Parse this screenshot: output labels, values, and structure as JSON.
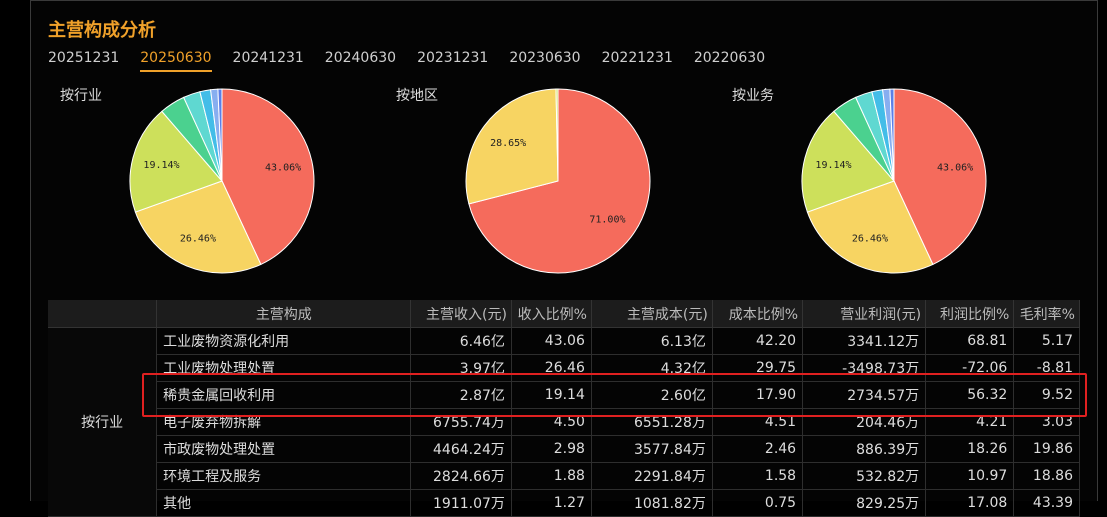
{
  "title": "主营构成分析",
  "tabs": [
    "20251231",
    "20250630",
    "20241231",
    "20240630",
    "20231231",
    "20230630",
    "20221231",
    "20220630"
  ],
  "active_tab": 1,
  "chart_data": [
    {
      "type": "pie",
      "title": "按行业",
      "slices": [
        {
          "value": 43.06,
          "label": "43.06%",
          "color": "#f56b5c"
        },
        {
          "value": 26.46,
          "label": "26.46%",
          "color": "#f7d462"
        },
        {
          "value": 19.14,
          "label": "19.14%",
          "color": "#cde05b"
        },
        {
          "value": 4.5,
          "label": "",
          "color": "#4bd18f"
        },
        {
          "value": 2.98,
          "label": "",
          "color": "#5fd8d1"
        },
        {
          "value": 1.88,
          "label": "",
          "color": "#43bde8"
        },
        {
          "value": 1.27,
          "label": "",
          "color": "#87aef0"
        },
        {
          "value": 0.71,
          "label": "",
          "color": "#5b7fe8"
        }
      ]
    },
    {
      "type": "pie",
      "title": "按地区",
      "slices": [
        {
          "value": 71.0,
          "label": "71.00%",
          "color": "#f56b5c"
        },
        {
          "value": 28.65,
          "label": "28.65%",
          "color": "#f7d462"
        },
        {
          "value": 0.35,
          "label": "",
          "color": "#cde05b"
        }
      ]
    },
    {
      "type": "pie",
      "title": "按业务",
      "slices": [
        {
          "value": 43.06,
          "label": "43.06%",
          "color": "#f56b5c"
        },
        {
          "value": 26.46,
          "label": "26.46%",
          "color": "#f7d462"
        },
        {
          "value": 19.14,
          "label": "19.14%",
          "color": "#cde05b"
        },
        {
          "value": 4.5,
          "label": "",
          "color": "#4bd18f"
        },
        {
          "value": 2.98,
          "label": "",
          "color": "#5fd8d1"
        },
        {
          "value": 1.88,
          "label": "",
          "color": "#43bde8"
        },
        {
          "value": 1.27,
          "label": "",
          "color": "#87aef0"
        },
        {
          "value": 0.71,
          "label": "",
          "color": "#5b7fe8"
        }
      ]
    }
  ],
  "table": {
    "headers": [
      "主营构成",
      "主营收入(元)",
      "收入比例%",
      "主营成本(元)",
      "成本比例%",
      "营业利润(元)",
      "利润比例%",
      "毛利率%"
    ],
    "group_label": "按行业",
    "rows": [
      [
        "工业废物资源化利用",
        "6.46亿",
        "43.06",
        "6.13亿",
        "42.20",
        "3341.12万",
        "68.81",
        "5.17"
      ],
      [
        "工业废物处理处置",
        "3.97亿",
        "26.46",
        "4.32亿",
        "29.75",
        "-3498.73万",
        "-72.06",
        "-8.81"
      ],
      [
        "稀贵金属回收利用",
        "2.87亿",
        "19.14",
        "2.60亿",
        "17.90",
        "2734.57万",
        "56.32",
        "9.52"
      ],
      [
        "电子废弃物拆解",
        "6755.74万",
        "4.50",
        "6551.28万",
        "4.51",
        "204.46万",
        "4.21",
        "3.03"
      ],
      [
        "市政废物处理处置",
        "4464.24万",
        "2.98",
        "3577.84万",
        "2.46",
        "886.39万",
        "18.26",
        "19.86"
      ],
      [
        "环境工程及服务",
        "2824.66万",
        "1.88",
        "2291.84万",
        "1.58",
        "532.82万",
        "10.97",
        "18.86"
      ],
      [
        "其他",
        "1911.07万",
        "1.27",
        "1081.82万",
        "0.75",
        "829.25万",
        "17.08",
        "43.39"
      ]
    ]
  }
}
